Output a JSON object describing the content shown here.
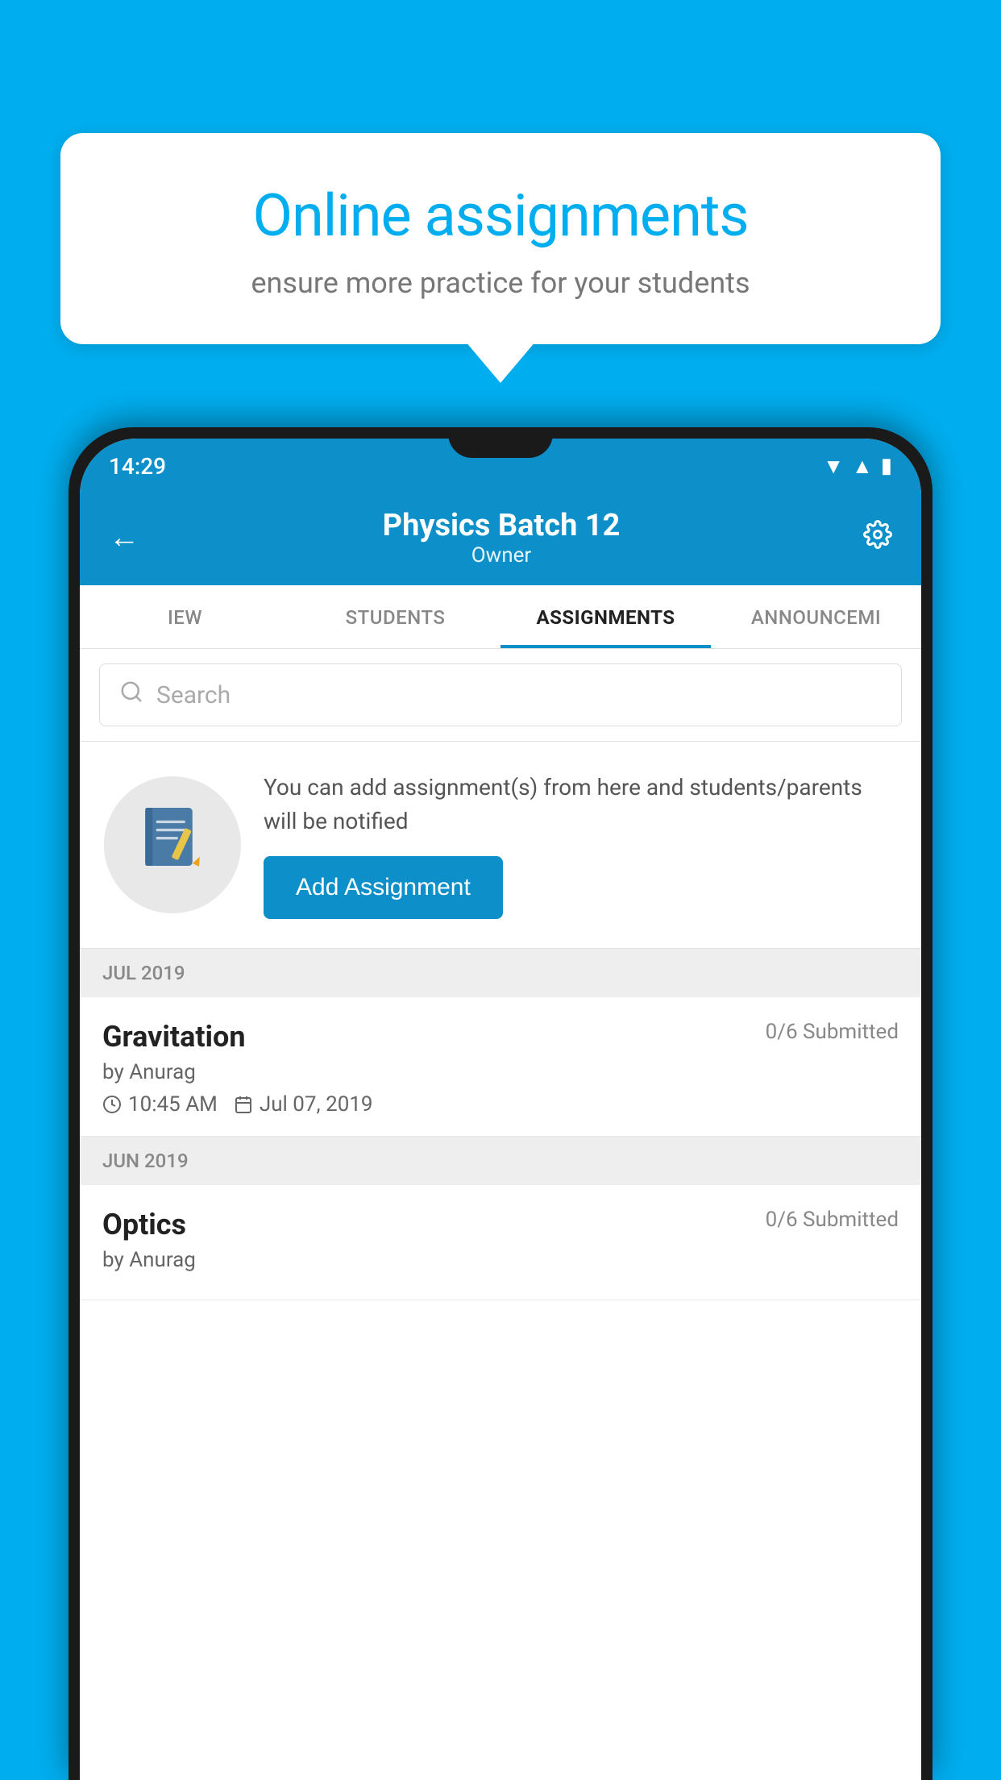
{
  "background": {
    "color": "#00AEEF"
  },
  "info_card": {
    "title": "Online assignments",
    "subtitle": "ensure more practice for your students"
  },
  "status_bar": {
    "time": "14:29",
    "icons": [
      "wifi",
      "signal",
      "battery"
    ]
  },
  "header": {
    "title": "Physics Batch 12",
    "subtitle": "Owner",
    "back_label": "←",
    "settings_label": "⚙"
  },
  "tabs": [
    {
      "label": "IEW",
      "active": false
    },
    {
      "label": "STUDENTS",
      "active": false
    },
    {
      "label": "ASSIGNMENTS",
      "active": true
    },
    {
      "label": "ANNOUNCEMI",
      "active": false
    }
  ],
  "search": {
    "placeholder": "Search"
  },
  "promo": {
    "description": "You can add assignment(s) from here and students/parents will be notified",
    "add_button_label": "Add Assignment"
  },
  "sections": [
    {
      "month": "JUL 2019",
      "assignments": [
        {
          "title": "Gravitation",
          "submitted": "0/6 Submitted",
          "by": "by Anurag",
          "time": "10:45 AM",
          "date": "Jul 07, 2019"
        }
      ]
    },
    {
      "month": "JUN 2019",
      "assignments": [
        {
          "title": "Optics",
          "submitted": "0/6 Submitted",
          "by": "by Anurag",
          "time": "",
          "date": ""
        }
      ]
    }
  ]
}
